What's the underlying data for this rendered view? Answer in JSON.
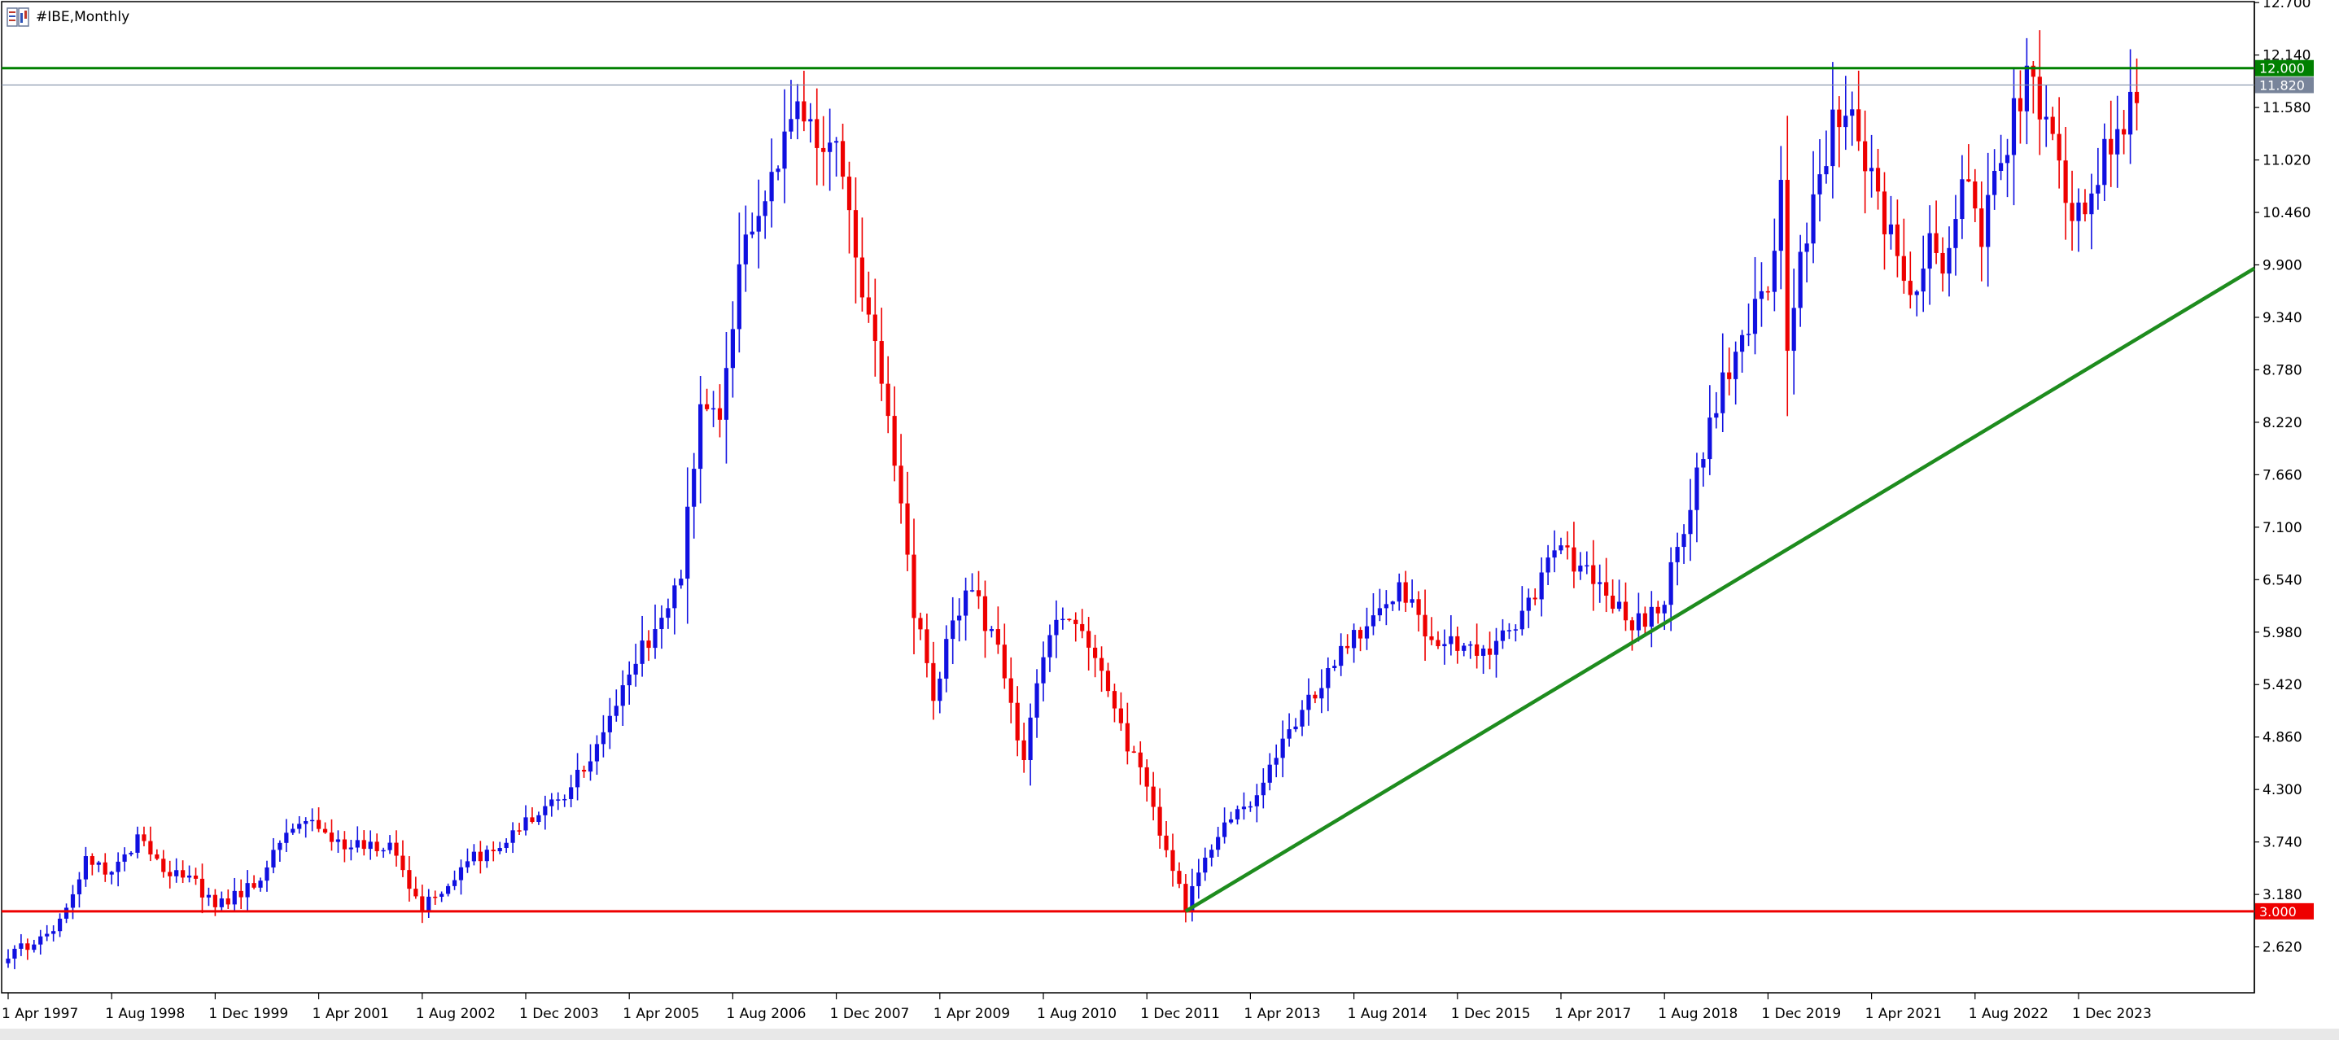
{
  "window": {
    "title": "#IBE,Monthly"
  },
  "colors": {
    "bull": "#1010e0",
    "bear": "#ee0000",
    "resistance": "#008000",
    "support": "#ee0000",
    "trend": "#1e8c1e",
    "price_line": "#8090a8",
    "badge_price": "#78849a"
  },
  "chart_data": {
    "type": "candlestick",
    "title": "#IBE,Monthly",
    "xlabel": "",
    "ylabel": "",
    "ylim": [
      2.13,
      12.71
    ],
    "grid": false,
    "x_range": [
      "1997-04",
      "2024-09"
    ],
    "y_ticks": [
      "12.700",
      "12.140",
      "11.580",
      "11.020",
      "10.460",
      "9.900",
      "9.340",
      "8.780",
      "8.220",
      "7.660",
      "7.100",
      "6.540",
      "5.980",
      "5.420",
      "4.860",
      "4.300",
      "3.740",
      "3.180",
      "2.620"
    ],
    "x_ticks": [
      {
        "label": "1 Apr 1997",
        "date": "1997-04"
      },
      {
        "label": "1 Aug 1998",
        "date": "1998-08"
      },
      {
        "label": "1 Dec 1999",
        "date": "1999-12"
      },
      {
        "label": "1 Apr 2001",
        "date": "2001-04"
      },
      {
        "label": "1 Aug 2002",
        "date": "2002-08"
      },
      {
        "label": "1 Dec 2003",
        "date": "2003-12"
      },
      {
        "label": "1 Apr 2005",
        "date": "2005-04"
      },
      {
        "label": "1 Aug 2006",
        "date": "2006-08"
      },
      {
        "label": "1 Dec 2007",
        "date": "2007-12"
      },
      {
        "label": "1 Apr 2009",
        "date": "2009-04"
      },
      {
        "label": "1 Aug 2010",
        "date": "2010-08"
      },
      {
        "label": "1 Dec 2011",
        "date": "2011-12"
      },
      {
        "label": "1 Apr 2013",
        "date": "2013-04"
      },
      {
        "label": "1 Aug 2014",
        "date": "2014-08"
      },
      {
        "label": "1 Dec 2015",
        "date": "2015-12"
      },
      {
        "label": "1 Apr 2017",
        "date": "2017-04"
      },
      {
        "label": "1 Aug 2018",
        "date": "2018-08"
      },
      {
        "label": "1 Dec 2019",
        "date": "2019-12"
      },
      {
        "label": "1 Apr 2021",
        "date": "2021-04"
      },
      {
        "label": "1 Aug 2022",
        "date": "2022-08"
      },
      {
        "label": "1 Dec 2023",
        "date": "2023-12"
      }
    ],
    "anchors": [
      {
        "date": "1997-04",
        "close": 2.55
      },
      {
        "date": "1997-10",
        "close": 2.7
      },
      {
        "date": "1998-01",
        "close": 3.1
      },
      {
        "date": "1998-04",
        "close": 3.55
      },
      {
        "date": "1998-08",
        "close": 3.4
      },
      {
        "date": "1998-12",
        "close": 3.8
      },
      {
        "date": "1999-03",
        "close": 3.5
      },
      {
        "date": "1999-09",
        "close": 3.3
      },
      {
        "date": "1999-12",
        "close": 3.05
      },
      {
        "date": "2000-06",
        "close": 3.3
      },
      {
        "date": "2000-09",
        "close": 3.6
      },
      {
        "date": "2001-02",
        "close": 4.0
      },
      {
        "date": "2001-06",
        "close": 3.75
      },
      {
        "date": "2002-03",
        "close": 3.7
      },
      {
        "date": "2002-08",
        "close": 3.05
      },
      {
        "date": "2002-10",
        "close": 3.15
      },
      {
        "date": "2003-03",
        "close": 3.55
      },
      {
        "date": "2003-08",
        "close": 3.7
      },
      {
        "date": "2003-12",
        "close": 4.0
      },
      {
        "date": "2004-06",
        "close": 4.2
      },
      {
        "date": "2004-12",
        "close": 4.9
      },
      {
        "date": "2005-06",
        "close": 5.8
      },
      {
        "date": "2005-12",
        "close": 6.6
      },
      {
        "date": "2006-03",
        "close": 8.5
      },
      {
        "date": "2006-06",
        "close": 8.2
      },
      {
        "date": "2006-09",
        "close": 9.8
      },
      {
        "date": "2007-01",
        "close": 10.8
      },
      {
        "date": "2007-06",
        "close": 11.4
      },
      {
        "date": "2007-12",
        "close": 11.2
      },
      {
        "date": "2008-03",
        "close": 10.0
      },
      {
        "date": "2008-06",
        "close": 9.0
      },
      {
        "date": "2008-09",
        "close": 7.8
      },
      {
        "date": "2008-12",
        "close": 6.2
      },
      {
        "date": "2009-03",
        "close": 5.3
      },
      {
        "date": "2009-06",
        "close": 6.2
      },
      {
        "date": "2009-09",
        "close": 6.4
      },
      {
        "date": "2010-01",
        "close": 5.8
      },
      {
        "date": "2010-05",
        "close": 4.6
      },
      {
        "date": "2010-07",
        "close": 5.4
      },
      {
        "date": "2010-10",
        "close": 6.2
      },
      {
        "date": "2011-02",
        "close": 6.0
      },
      {
        "date": "2011-06",
        "close": 5.3
      },
      {
        "date": "2011-09",
        "close": 4.8
      },
      {
        "date": "2012-01",
        "close": 4.1
      },
      {
        "date": "2012-06",
        "close": 3.05
      },
      {
        "date": "2012-08",
        "close": 3.4
      },
      {
        "date": "2012-12",
        "close": 3.9
      },
      {
        "date": "2013-05",
        "close": 4.2
      },
      {
        "date": "2013-10",
        "close": 4.9
      },
      {
        "date": "2014-04",
        "close": 5.6
      },
      {
        "date": "2014-09",
        "close": 6.0
      },
      {
        "date": "2015-03",
        "close": 6.4
      },
      {
        "date": "2015-09",
        "close": 5.9
      },
      {
        "date": "2016-04",
        "close": 5.8
      },
      {
        "date": "2016-09",
        "close": 6.1
      },
      {
        "date": "2017-04",
        "close": 6.9
      },
      {
        "date": "2017-10",
        "close": 6.5
      },
      {
        "date": "2018-03",
        "close": 6.0
      },
      {
        "date": "2018-08",
        "close": 6.4
      },
      {
        "date": "2018-12",
        "close": 7.4
      },
      {
        "date": "2019-06",
        "close": 8.8
      },
      {
        "date": "2019-12",
        "close": 9.6
      },
      {
        "date": "2020-02",
        "close": 10.8
      },
      {
        "date": "2020-03",
        "close": 9.0
      },
      {
        "date": "2020-07",
        "close": 10.8
      },
      {
        "date": "2020-11",
        "close": 11.5
      },
      {
        "date": "2021-01",
        "close": 11.6
      },
      {
        "date": "2021-04",
        "close": 10.9
      },
      {
        "date": "2021-08",
        "close": 10.0
      },
      {
        "date": "2021-10",
        "close": 9.4
      },
      {
        "date": "2022-01",
        "close": 10.2
      },
      {
        "date": "2022-03",
        "close": 9.8
      },
      {
        "date": "2022-06",
        "close": 10.8
      },
      {
        "date": "2022-09",
        "close": 10.2
      },
      {
        "date": "2022-12",
        "close": 11.0
      },
      {
        "date": "2023-04",
        "close": 11.9
      },
      {
        "date": "2023-07",
        "close": 11.6
      },
      {
        "date": "2023-10",
        "close": 10.6
      },
      {
        "date": "2023-12",
        "close": 10.4
      },
      {
        "date": "2024-03",
        "close": 11.0
      },
      {
        "date": "2024-09",
        "close": 11.82
      }
    ],
    "levels": [
      {
        "value": 12.0,
        "label": "12.000",
        "role": "resistance"
      },
      {
        "value": 11.82,
        "label": "11.820",
        "role": "last-price"
      },
      {
        "value": 3.0,
        "label": "3.000",
        "role": "support"
      }
    ],
    "trendline": {
      "from": {
        "date": "2012-06",
        "value": 3.0
      },
      "to": {
        "date": "2030-03",
        "value": 11.85
      }
    }
  }
}
